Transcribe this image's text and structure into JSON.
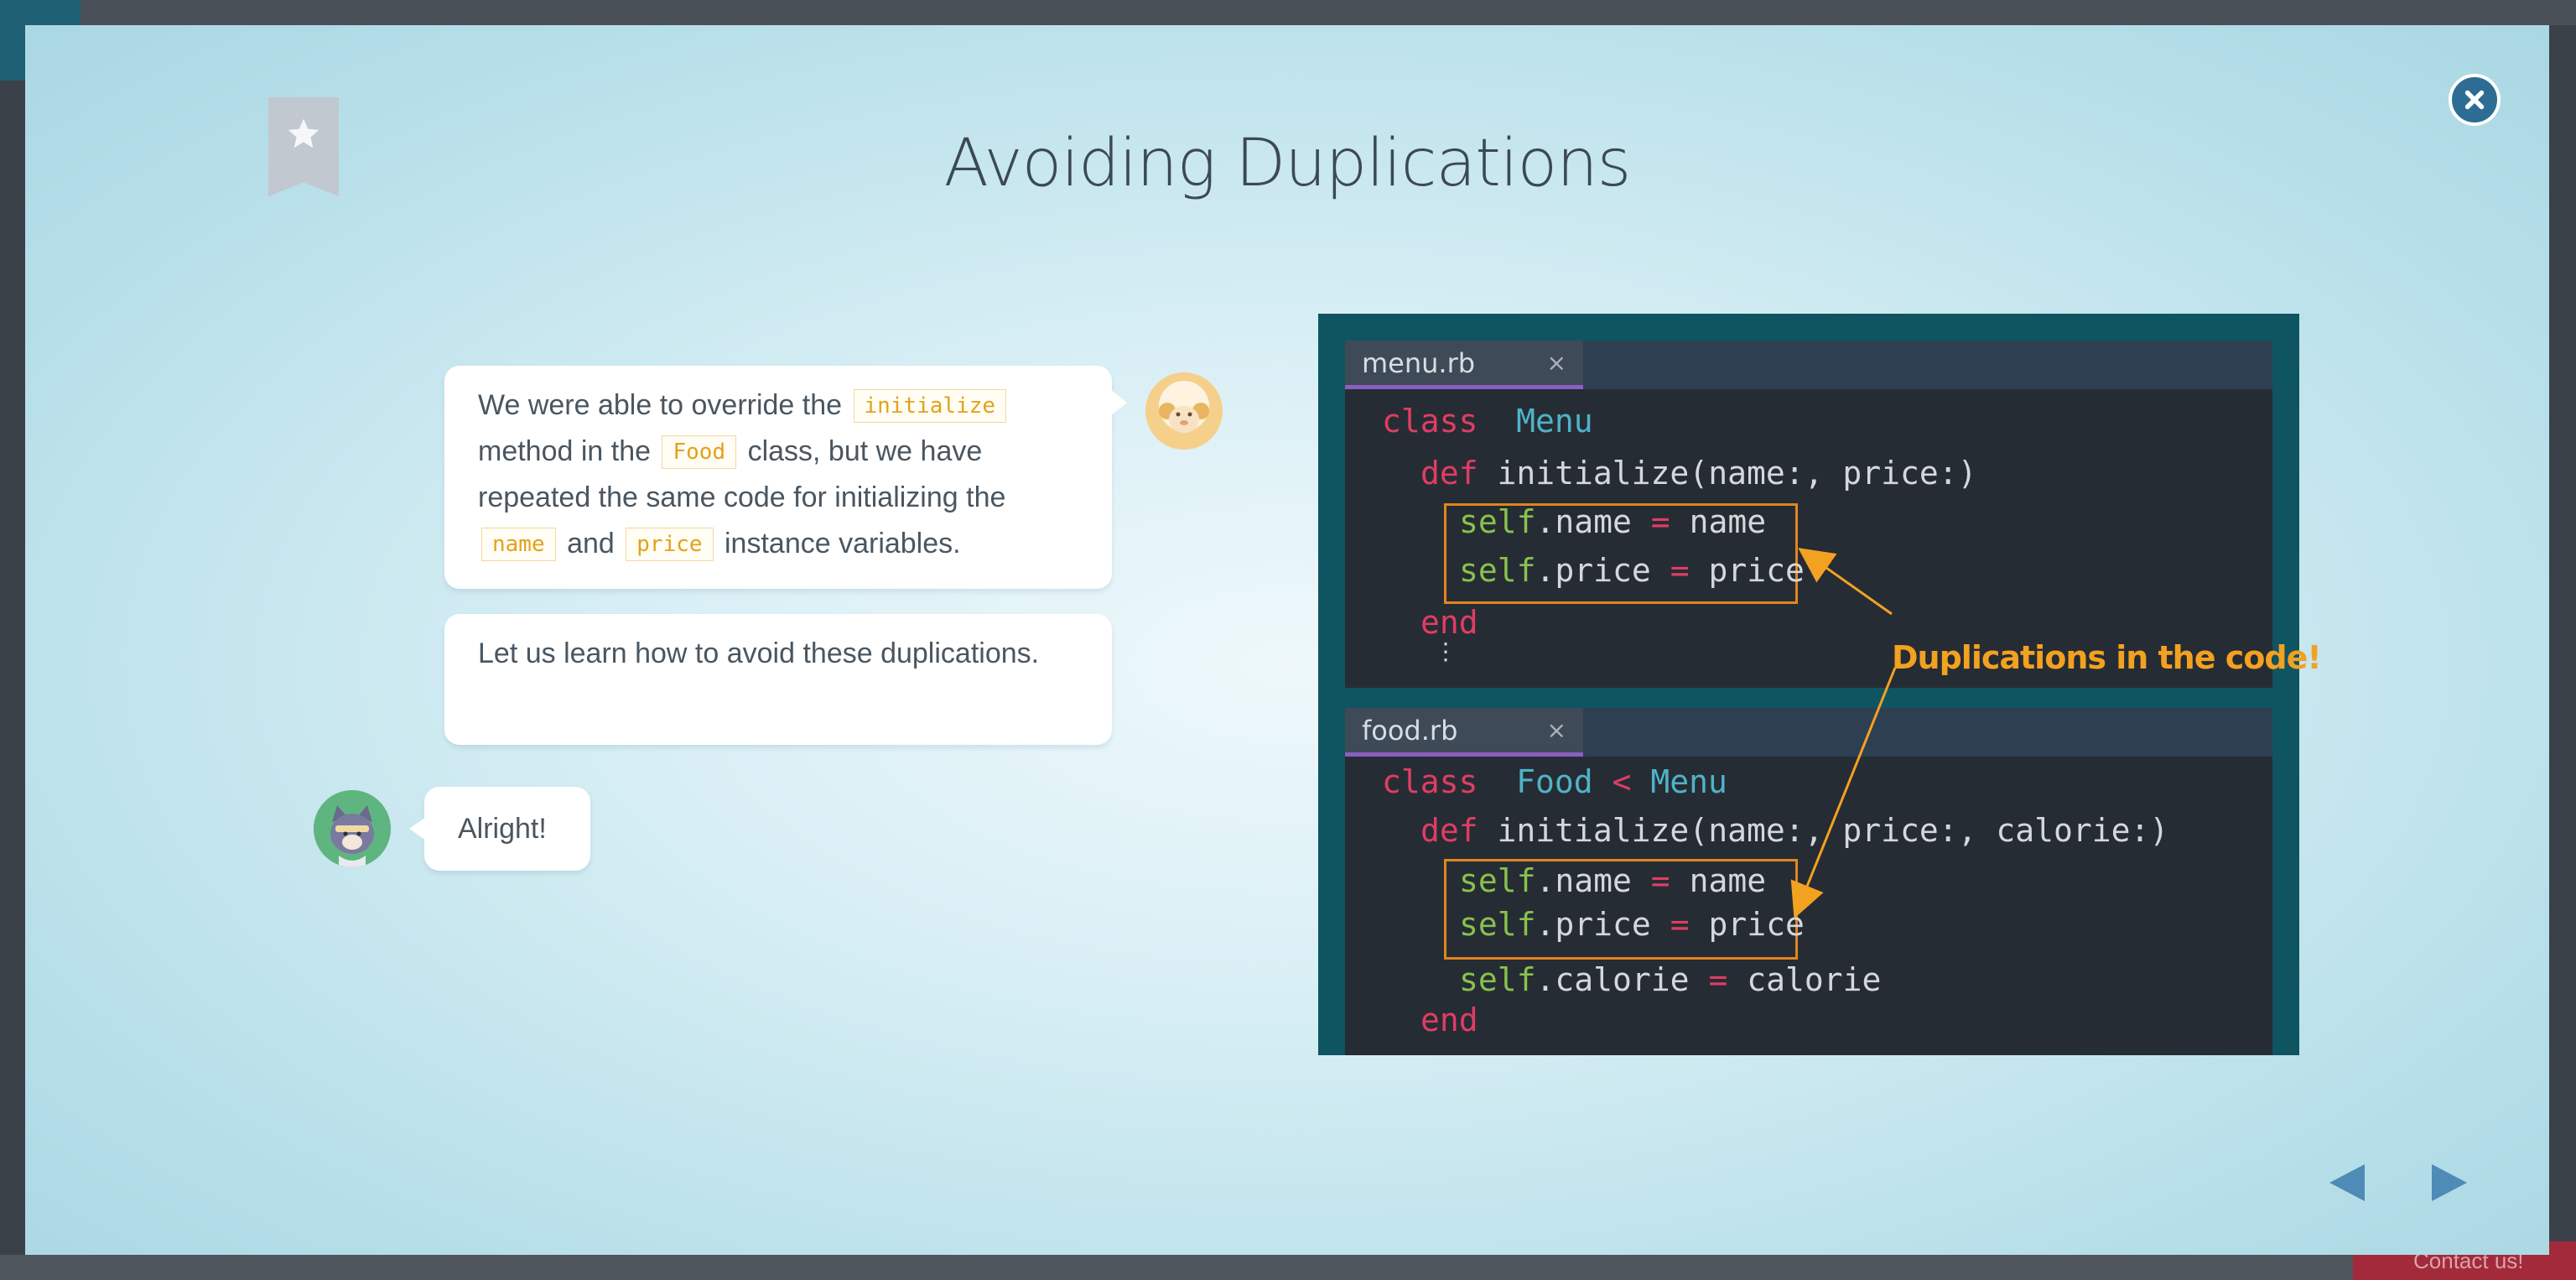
{
  "background": {
    "contact_label": "Contact us!"
  },
  "modal": {
    "title": "Avoiding Duplications",
    "close_icon": "close-icon",
    "bookmark_icon": "star-icon"
  },
  "chat": {
    "bubble1": {
      "part1": "We were able to override the",
      "code1": "initialize",
      "part2": "method in the",
      "code2": "Food",
      "part3": "class, but we have repeated the same code for initializing the",
      "code3": "name",
      "part4": "and",
      "code4": "price",
      "part5": "instance variables."
    },
    "bubble2": "Let us learn how to avoid these duplications.",
    "bubble3": "Alright!"
  },
  "slide": {
    "tab1": "menu.rb",
    "tab2": "food.rb",
    "tab_close": "×",
    "annotation": "Duplications in the code!",
    "menu_code": {
      "kw_class": "class",
      "class_name": "Menu",
      "kw_def": "def",
      "method_sig": "initialize(name:, price:)",
      "self": "self",
      "line_name": ".name",
      "line_price": ".price",
      "eq": "=",
      "rhs_name": "name",
      "rhs_price": "price",
      "kw_end": "end",
      "ellipsis": "⋮"
    },
    "food_code": {
      "kw_class": "class",
      "class_name": "Food",
      "lt": "<",
      "parent": "Menu",
      "kw_def": "def",
      "method_sig": "initialize(name:, price:, calorie:)",
      "self": "self",
      "line_name": ".name",
      "line_price": ".price",
      "line_calorie": ".calorie",
      "eq": "=",
      "rhs_name": "name",
      "rhs_price": "price",
      "rhs_calorie": "calorie",
      "kw_end": "end"
    }
  },
  "navigation": {
    "prev_icon": "left-triangle-icon",
    "next_icon": "right-triangle-icon"
  },
  "colors": {
    "accent": "#2d6c93",
    "code_keyword": "#e03d64",
    "code_class": "#4fb2c9",
    "code_self": "#88c14e",
    "highlight": "#e0861f",
    "annotation": "#f3a121"
  }
}
